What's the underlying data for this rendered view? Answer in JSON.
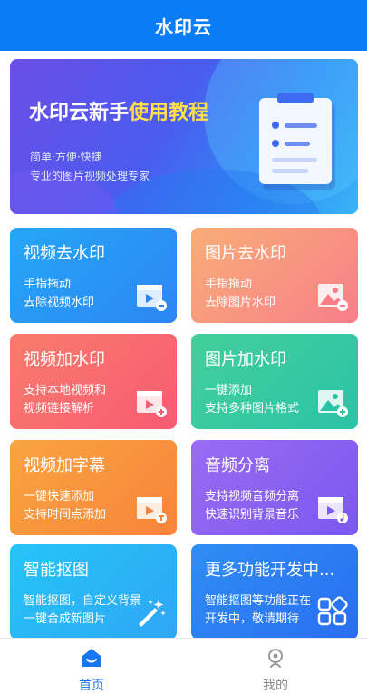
{
  "header": {
    "title": "水印云"
  },
  "banner": {
    "title_main": "水印云新手",
    "title_highlight": "使用教程",
    "subtitle1": "简单·方便·快捷",
    "subtitle2": "专业的图片视频处理专家",
    "colors": {
      "highlight": "#ffe04a"
    }
  },
  "cards": [
    {
      "title": "视频去水印",
      "desc1": "手指拖动",
      "desc2": "去除视频水印",
      "icon": "video-remove-icon"
    },
    {
      "title": "图片去水印",
      "desc1": "手指拖动",
      "desc2": "去除图片水印",
      "icon": "image-remove-icon"
    },
    {
      "title": "视频加水印",
      "desc1": "支持本地视频和",
      "desc2": "视频链接解析",
      "icon": "video-add-icon"
    },
    {
      "title": "图片加水印",
      "desc1": "一键添加",
      "desc2": "支持多种图片格式",
      "icon": "image-add-icon"
    },
    {
      "title": "视频加字幕",
      "desc1": "一键快速添加",
      "desc2": "支持时间点添加",
      "icon": "video-subtitle-icon"
    },
    {
      "title": "音频分离",
      "desc1": "支持视频音频分离",
      "desc2": "快速识别背景音乐",
      "icon": "video-audio-icon"
    },
    {
      "title": "智能抠图",
      "desc1": "智能抠图，自定义背景",
      "desc2": "一键合成新图片",
      "icon": "magic-wand-icon"
    },
    {
      "title": "更多功能开发中...",
      "desc1": "智能抠图等功能正在",
      "desc2": "开发中，敬请期待",
      "icon": "apps-grid-icon"
    }
  ],
  "tabbar": {
    "home_label": "首页",
    "mine_label": "我的",
    "colors": {
      "active": "#1677f5",
      "inactive": "#8a8a8a"
    }
  }
}
